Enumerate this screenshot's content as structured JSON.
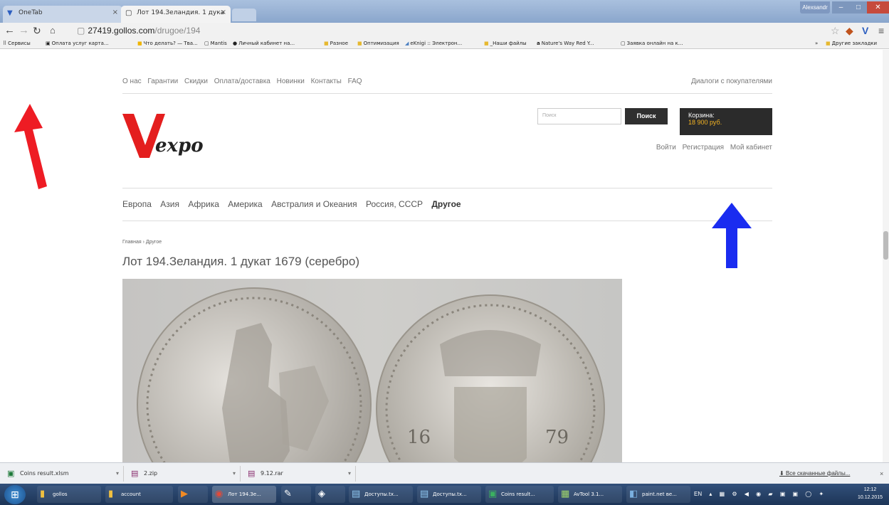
{
  "browser": {
    "tabs": [
      {
        "title": "OneTab"
      },
      {
        "title": "Лот 194.Зеландия. 1 дука"
      }
    ],
    "window_user": "Alexsandr",
    "url_host": "27419.gollos.com",
    "url_path": "/drugoe/194",
    "bookmarks": [
      "Сервисы",
      "Оплата услуг карта...",
      "Что делать? — Тва...",
      "Mantis",
      "Личный кабинет на...",
      "Разное",
      "Оптимизация",
      "eKnigi :: Электрон...",
      "_Наши файлы",
      "Nature's Way Red Y...",
      "Заявка онлайн на к...",
      "Другие закладки"
    ]
  },
  "site": {
    "topnav": [
      "О нас",
      "Гарантии",
      "Скидки",
      "Оплата/доставка",
      "Новинки",
      "Контакты",
      "FAQ"
    ],
    "dialogs": "Диалоги с покупателями",
    "logo_text": "expo",
    "search_placeholder": "Поиск",
    "search_button": "Поиск",
    "cart_label": "Корзина:",
    "cart_value": "18 900 руб.",
    "auth_links": [
      "Войти",
      "Регистрация",
      "Мой кабинет"
    ],
    "categories": [
      "Европа",
      "Азия",
      "Африка",
      "Америка",
      "Австралия и Океания",
      "Россия, СССР",
      "Другое"
    ],
    "breadcrumb": "Главная › Другое",
    "title": "Лот 194.Зеландия. 1 дукат 1679 (серебро)",
    "coin_year_left": "16",
    "coin_year_right": "79"
  },
  "downloads": {
    "items": [
      "Coins result.xlsm",
      "2.zip",
      "9.12.rar"
    ],
    "all": "Все скачанные файлы..."
  },
  "taskbar": {
    "items": [
      "gollos",
      "account",
      "",
      "Лот 194.Зе...",
      "",
      "",
      "Доступы.tx...",
      "Доступы.tx...",
      "Coins result...",
      "AvTool 3.1...",
      "paint.net ве..."
    ],
    "lang": "EN",
    "time": "12:12",
    "date": "10.12.2015"
  },
  "colors": {
    "logo_red": "#e41e1e",
    "cart_value": "#f3b323",
    "arrow_red": "#ee1c24",
    "arrow_blue": "#1a2cf0"
  }
}
